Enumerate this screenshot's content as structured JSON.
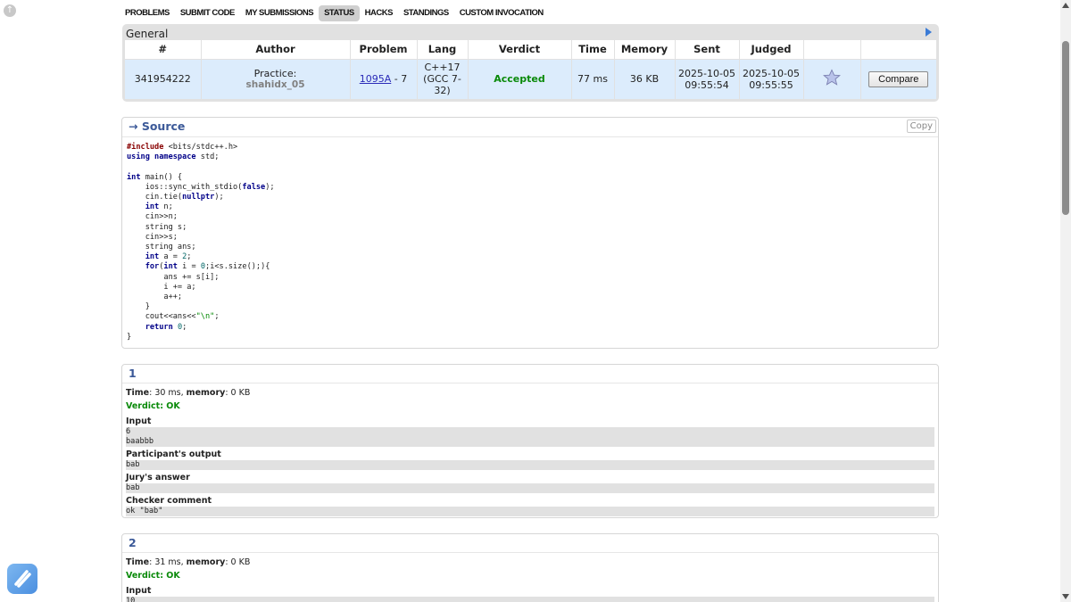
{
  "nav": [
    "PROBLEMS",
    "SUBMIT CODE",
    "MY SUBMISSIONS",
    "STATUS",
    "HACKS",
    "STANDINGS",
    "CUSTOM INVOCATION"
  ],
  "nav_active": "STATUS",
  "status": {
    "title": "General",
    "headers": [
      "#",
      "Author",
      "Problem",
      "Lang",
      "Verdict",
      "Time",
      "Memory",
      "Sent",
      "Judged",
      "",
      ""
    ],
    "row": {
      "id": "341954222",
      "author_prefix": "Practice:",
      "author_name": "shahidx_05",
      "problem_link": "1095A",
      "problem_suffix": " - 7",
      "lang": "C++17 (GCC 7-32)",
      "verdict": "Accepted",
      "time": "77 ms",
      "memory": "36 KB",
      "sent_date": "2025-10-05",
      "sent_time": "09:55:54",
      "judged_date": "2025-10-05",
      "judged_time": "09:55:55",
      "compare_label": "Compare"
    }
  },
  "source": {
    "title": "→ Source",
    "copy_label": "Copy"
  },
  "tests": [
    {
      "number": "1",
      "time_label": "Time",
      "time_value": ": 30 ms, ",
      "memory_label": "memory",
      "memory_value": ": 0 KB",
      "verdict": "Verdict: OK",
      "input_label": "Input",
      "input": "6\nbaabbb",
      "output_label": "Participant's output",
      "output": "bab",
      "answer_label": "Jury's answer",
      "answer": "bab",
      "checker_label": "Checker comment",
      "checker": "ok \"bab\""
    },
    {
      "number": "2",
      "time_label": "Time",
      "time_value": ": 31 ms, ",
      "memory_label": "memory",
      "memory_value": ": 0 KB",
      "verdict": "Verdict: OK",
      "input_label": "Input",
      "input": "10"
    }
  ],
  "colors": {
    "accepted": "#0a8a0a",
    "title_blue": "#3b5998",
    "row_bg": "#dcecfc",
    "box_bg": "#e1e1e1"
  },
  "icons": [
    "top-left-circle-icon",
    "play-arrow-icon",
    "star-icon",
    "app-icon",
    "scroll-up-icon",
    "scroll-down-icon"
  ]
}
